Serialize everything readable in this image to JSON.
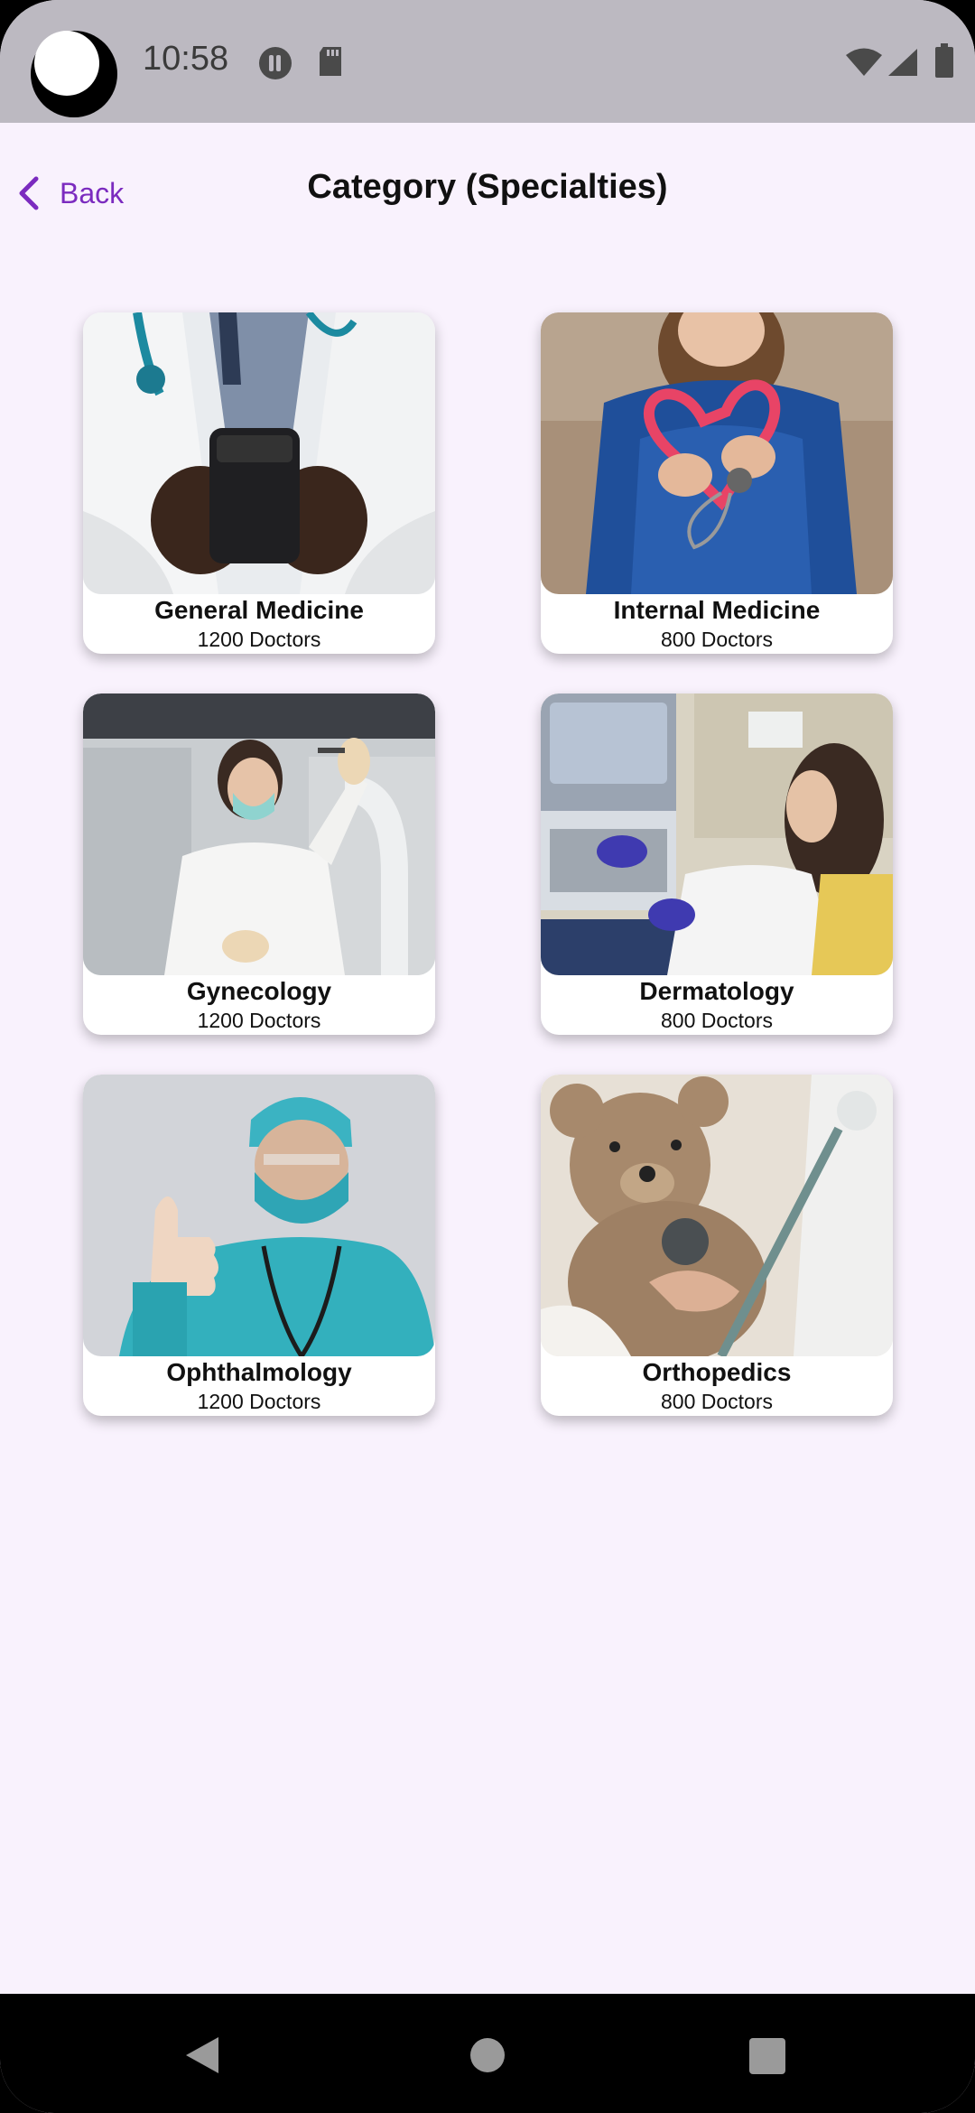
{
  "status_bar": {
    "time": "10:58",
    "icons": [
      "pause-circle-icon",
      "sd-card-icon",
      "wifi-icon",
      "signal-icon",
      "battery-icon"
    ]
  },
  "header": {
    "back_label": "Back",
    "back_icon": "chevron-left-icon",
    "title": "Category (Specialties)"
  },
  "categories": [
    {
      "name": "General Medicine",
      "count": "1200 Doctors"
    },
    {
      "name": "Internal Medicine",
      "count": "800 Doctors"
    },
    {
      "name": "Gynecology",
      "count": "1200 Doctors"
    },
    {
      "name": "Dermatology",
      "count": "800 Doctors"
    },
    {
      "name": "Ophthalmology",
      "count": "1200 Doctors"
    },
    {
      "name": "Orthopedics",
      "count": "800 Doctors"
    }
  ],
  "nav_bar": {
    "icons": [
      "back-triangle-icon",
      "home-circle-icon",
      "recents-square-icon"
    ]
  },
  "colors": {
    "accent": "#7b2bbf",
    "background": "#f9f2fd",
    "status_bar": "#bcb9c1"
  }
}
